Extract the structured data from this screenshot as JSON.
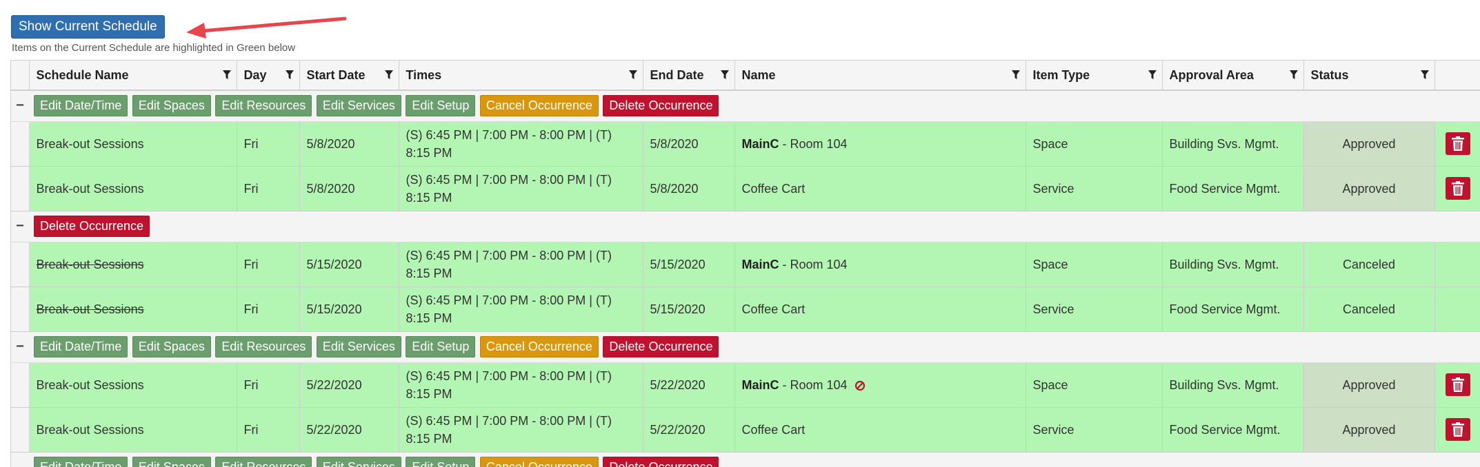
{
  "top_button": "Show Current Schedule",
  "hint": "Items on the Current Schedule are highlighted in Green below",
  "columns": [
    "Schedule Name",
    "Day",
    "Start Date",
    "Times",
    "End Date",
    "Name",
    "Item Type",
    "Approval Area",
    "Status"
  ],
  "toggle_symbol": "−",
  "actions": {
    "edit_datetime": "Edit Date/Time",
    "edit_spaces": "Edit Spaces",
    "edit_resources": "Edit Resources",
    "edit_services": "Edit Services",
    "edit_setup": "Edit Setup",
    "cancel_occurrence": "Cancel Occurrence",
    "delete_occurrence": "Delete Occurrence"
  },
  "groups": [
    {
      "rows": [
        {
          "schedule": "Break-out Sessions",
          "day": "Fri",
          "start": "5/8/2020",
          "times": "(S) 6:45 PM | 7:00 PM - 8:00 PM | (T) 8:15 PM",
          "end": "5/8/2020",
          "name_bold": "MainC",
          "name_rest": " - Room 104",
          "type": "Space",
          "area": "Building Svs. Mgmt.",
          "status": "Approved"
        },
        {
          "schedule": "Break-out Sessions",
          "day": "Fri",
          "start": "5/8/2020",
          "times": "(S) 6:45 PM | 7:00 PM - 8:00 PM | (T) 8:15 PM",
          "end": "5/8/2020",
          "name_plain": "Coffee Cart",
          "type": "Service",
          "area": "Food Service Mgmt.",
          "status": "Approved"
        }
      ]
    },
    {
      "rows": [
        {
          "schedule": "Break-out Sessions",
          "day": "Fri",
          "start": "5/15/2020",
          "times": "(S) 6:45 PM | 7:00 PM - 8:00 PM | (T) 8:15 PM",
          "end": "5/15/2020",
          "name_bold": "MainC",
          "name_rest": " - Room 104",
          "type": "Space",
          "area": "Building Svs. Mgmt.",
          "status": "Canceled"
        },
        {
          "schedule": "Break-out Sessions",
          "day": "Fri",
          "start": "5/15/2020",
          "times": "(S) 6:45 PM | 7:00 PM - 8:00 PM | (T) 8:15 PM",
          "end": "5/15/2020",
          "name_plain": "Coffee Cart",
          "type": "Service",
          "area": "Food Service Mgmt.",
          "status": "Canceled"
        }
      ]
    },
    {
      "rows": [
        {
          "schedule": "Break-out Sessions",
          "day": "Fri",
          "start": "5/22/2020",
          "times": "(S) 6:45 PM | 7:00 PM - 8:00 PM | (T) 8:15 PM",
          "end": "5/22/2020",
          "name_bold": "MainC",
          "name_rest": " - Room 104",
          "type": "Space",
          "area": "Building Svs. Mgmt.",
          "status": "Approved"
        },
        {
          "schedule": "Break-out Sessions",
          "day": "Fri",
          "start": "5/22/2020",
          "times": "(S) 6:45 PM | 7:00 PM - 8:00 PM | (T) 8:15 PM",
          "end": "5/22/2020",
          "name_plain": "Coffee Cart",
          "type": "Service",
          "area": "Food Service Mgmt.",
          "status": "Approved"
        }
      ]
    }
  ],
  "icons": {
    "filter": "filter-icon",
    "trash": "trash-icon",
    "no_symbol": "no-symbol-icon",
    "arrow": "red-arrow-annotation"
  },
  "colors": {
    "primary_button": "#2f6fb0",
    "approved_row": "#b3f5b3",
    "edit_button": "#6a9e6c",
    "cancel_button": "#d9960f",
    "delete_button": "#c0122e",
    "arrow": "#e8454a"
  }
}
